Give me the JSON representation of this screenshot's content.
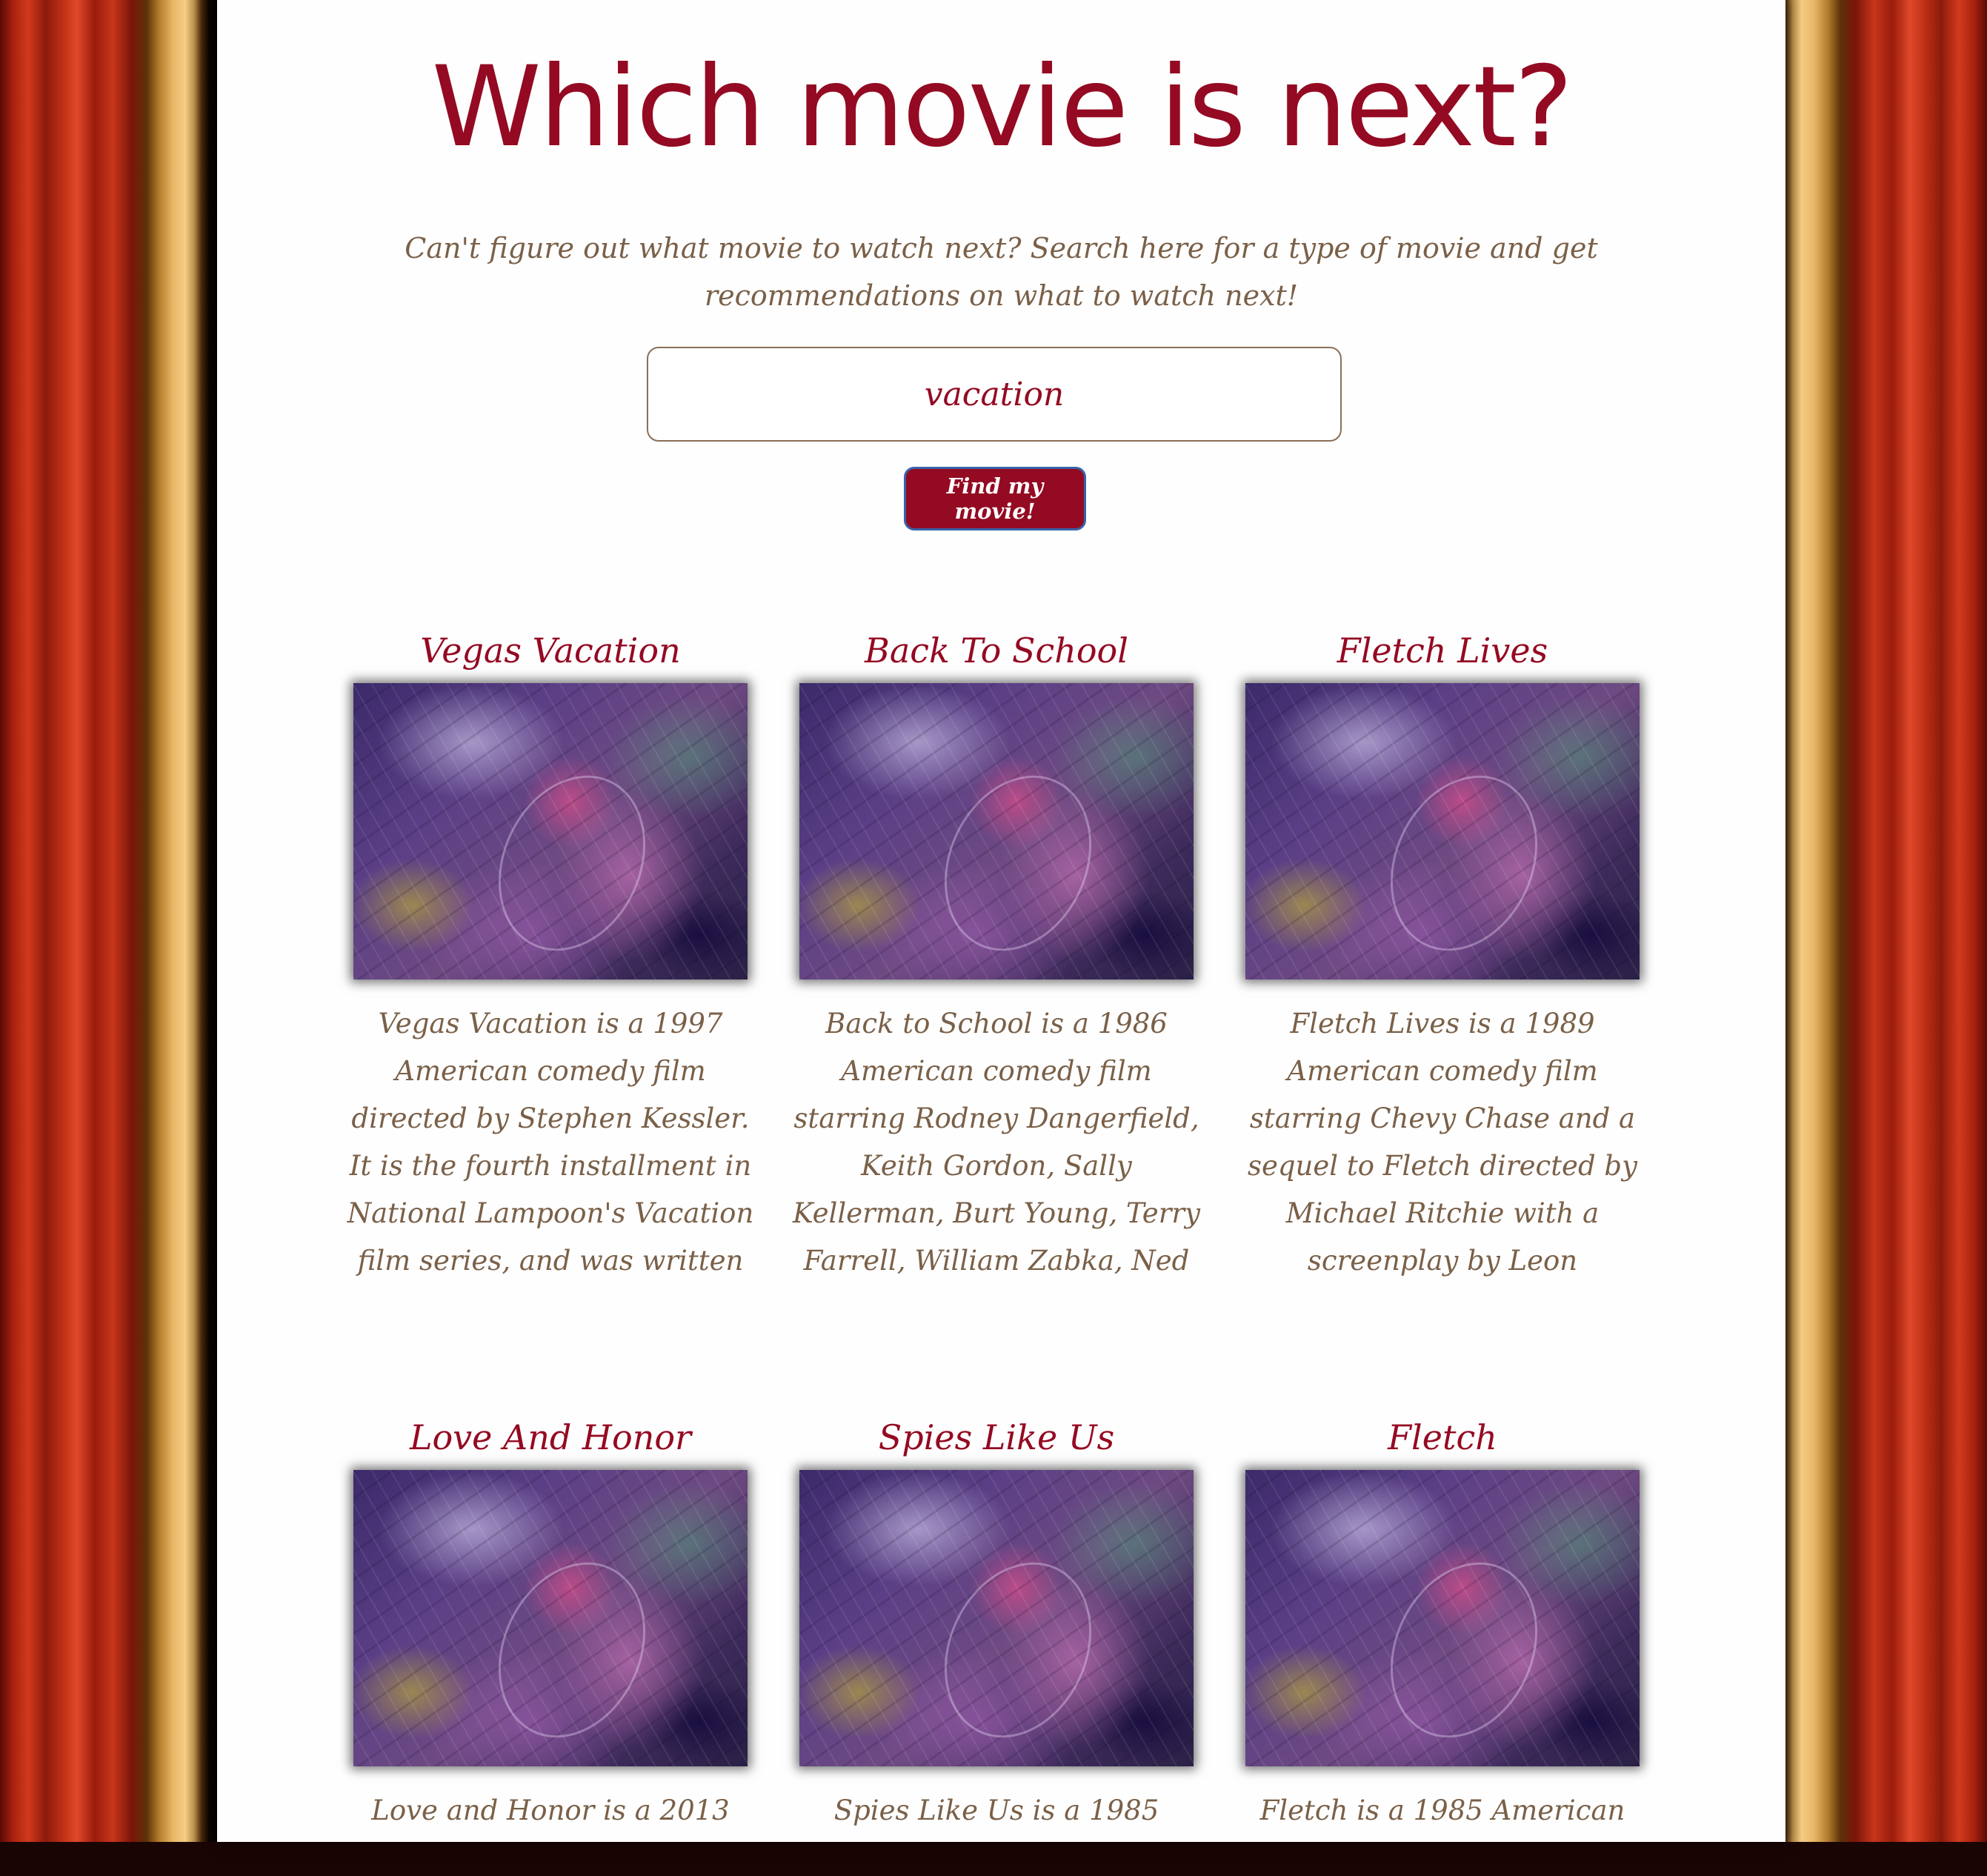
{
  "header": {
    "title": "Which movie is next?",
    "subtitle": "Can't figure out what movie to watch next? Search here for a type of movie and get recommendations on what to watch next!"
  },
  "search": {
    "value": "vacation",
    "button_label": "Find my movie!"
  },
  "movies": [
    {
      "title": "Vegas Vacation",
      "description": "Vegas Vacation is a 1997 American comedy film directed by Stephen Kessler. It is the fourth installment in National Lampoon's Vacation film series, and was written by Elisa Bell, based on a story by Bell and"
    },
    {
      "title": "Back To School",
      "description": "Back to School is a 1986 American comedy film starring Rodney Dangerfield, Keith Gordon, Sally Kellerman, Burt Young, Terry Farrell, William Zabka, Ned Beatty, Sam Kinison, Robert Downey Jr."
    },
    {
      "title": "Fletch Lives",
      "description": "Fletch Lives is a 1989 American comedy film starring Chevy Chase and a sequel to Fletch directed by Michael Ritchie with a screenplay by Leon Capetanos based on the characters created by Gregory"
    },
    {
      "title": "Love And Honor",
      "description": "Love and Honor is a 2013"
    },
    {
      "title": "Spies Like Us",
      "description": "Spies Like Us is a 1985"
    },
    {
      "title": "Fletch",
      "description": "Fletch is a 1985 American"
    }
  ]
}
